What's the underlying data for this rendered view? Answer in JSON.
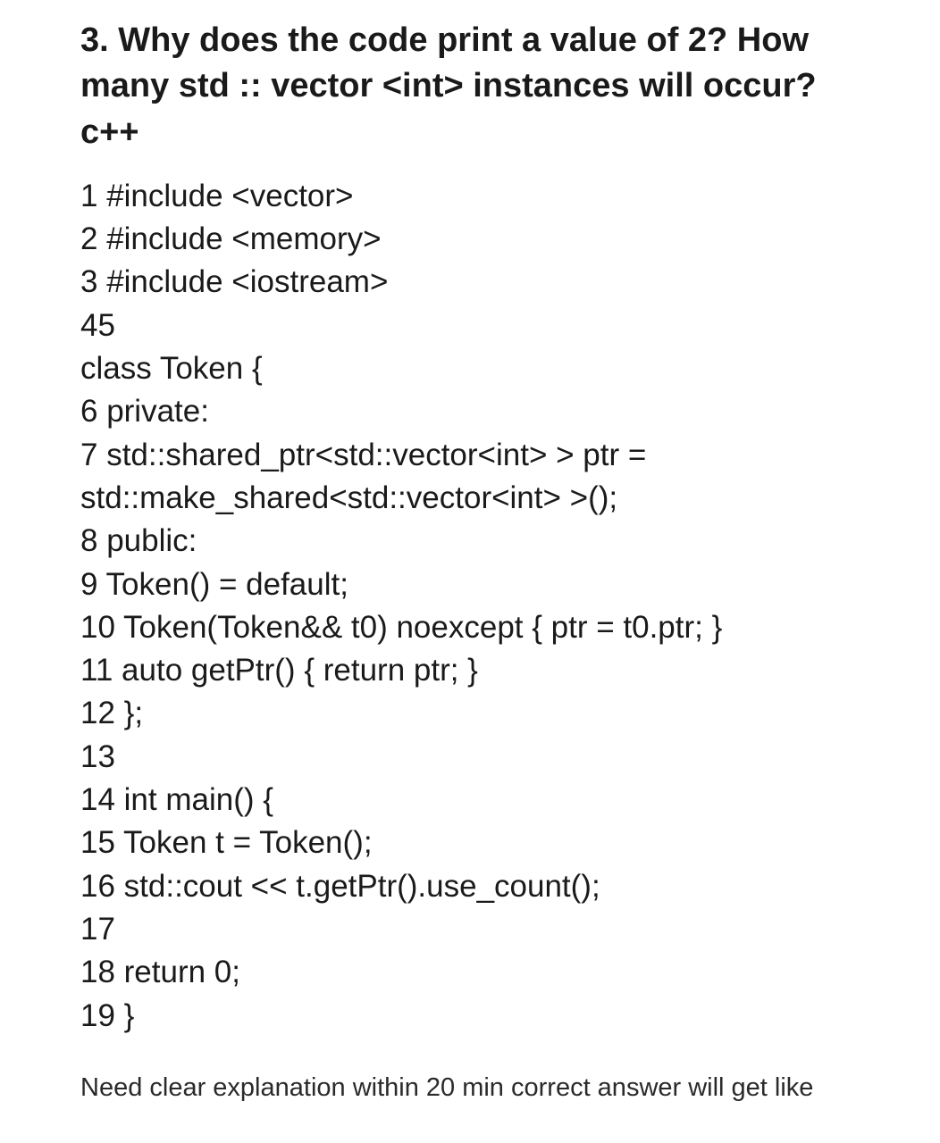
{
  "question": {
    "title": "3. Why does the code print a value of 2? How many std :: vector <int> instances will occur? c++"
  },
  "code_lines": [
    "1 #include <vector>",
    "2 #include <memory>",
    "3 #include <iostream>",
    "45",
    "class Token {",
    "6 private:",
    "7 std::shared_ptr<std::vector<int> > ptr = std::make_shared<std::vector<int> >();",
    "8 public:",
    "9 Token() = default;",
    "10 Token(Token&& t0) noexcept { ptr = t0.ptr; }",
    "11 auto getPtr() { return ptr; }",
    "12 };",
    "13",
    "14 int main() {",
    "15 Token t = Token();",
    "16 std::cout << t.getPtr().use_count();",
    "17",
    "18 return 0;",
    "19 }"
  ],
  "footer": {
    "note": "Need clear explanation within 20 min correct answer will get like"
  }
}
